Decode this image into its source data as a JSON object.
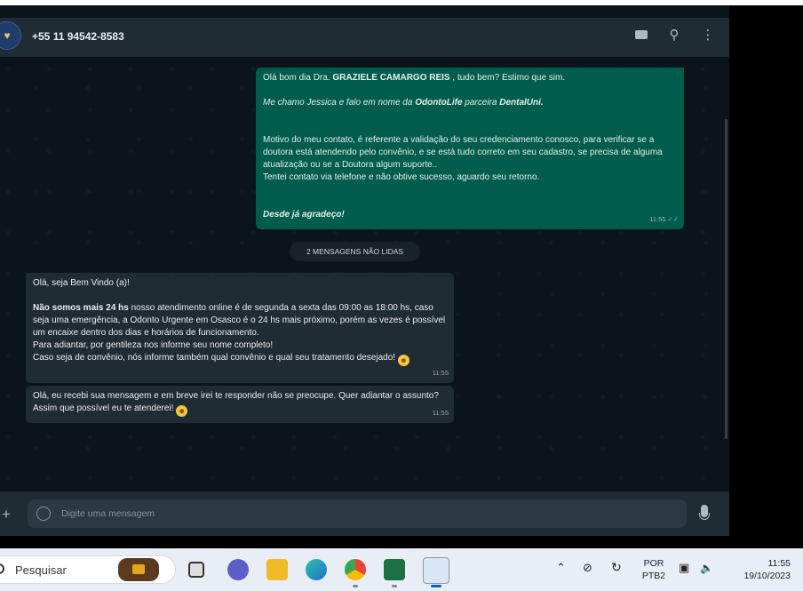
{
  "header": {
    "contact_name": "+55 11 94542-8583"
  },
  "messages": {
    "outgoing": {
      "line1_prefix": "Olá bom dia Dra. ",
      "line1_name": "GRAZIELE CAMARGO REIS",
      "line1_suffix": " , tudo bem? Estimo que sim.",
      "line2_prefix": "Me chamo Jessica e falo em nome da ",
      "line2_brand1": "OdontoLife",
      "line2_middle": " parceira ",
      "line2_brand2": "DentalUni.",
      "para": "Motivo do meu contato, é referente a validação do seu credenciamento conosco, para verificar se a doutora está atendendo pelo convênio, e se está tudo correto em seu cadastro, se precisa de alguma atualização ou se a Doutora algum suporte..",
      "para2": "Tentei contato via telefone e não obtive sucesso, aguardo seu retorno.",
      "closing": "Desde já agradeço!",
      "time": "11:55"
    },
    "unread_label": "2 MENSAGENS NÃO LIDAS",
    "incoming1": {
      "greeting": "Olá,  seja Bem Vindo (a)!",
      "bold": "Não somos mais 24 hs",
      "rest": "  nosso atendimento online é de segunda a sexta das 09:00 as 18:00 hs, caso seja uma emergência, a Odonto Urgente em Osasco é o 24 hs mais próximo, porém as vezes é possível um encaixe dentro dos dias e horários de funcionamento.",
      "line3": "Para adiantar, por gentileza nos informe seu nome completo!",
      "line4": "Caso seja de convênio, nós informe também qual convênio e qual seu tratamento desejado!",
      "time": "11:55"
    },
    "incoming2": {
      "text": "Olá, eu recebi sua mensagem e em breve irei te responder não se preocupe. Quer adiantar o assunto? Assim que possível eu te atenderei!",
      "time": "11:55"
    }
  },
  "composer": {
    "placeholder": "Digite uma mensagem"
  },
  "taskbar": {
    "search_label": "Pesquisar",
    "lang_top": "POR",
    "lang_bottom": "PTB2",
    "clock_time": "11:55",
    "clock_date": "19/10/2023"
  },
  "colors": {
    "outgoing_bubble": "#005c4b",
    "incoming_bubble": "#202c33",
    "header": "#202c33"
  }
}
